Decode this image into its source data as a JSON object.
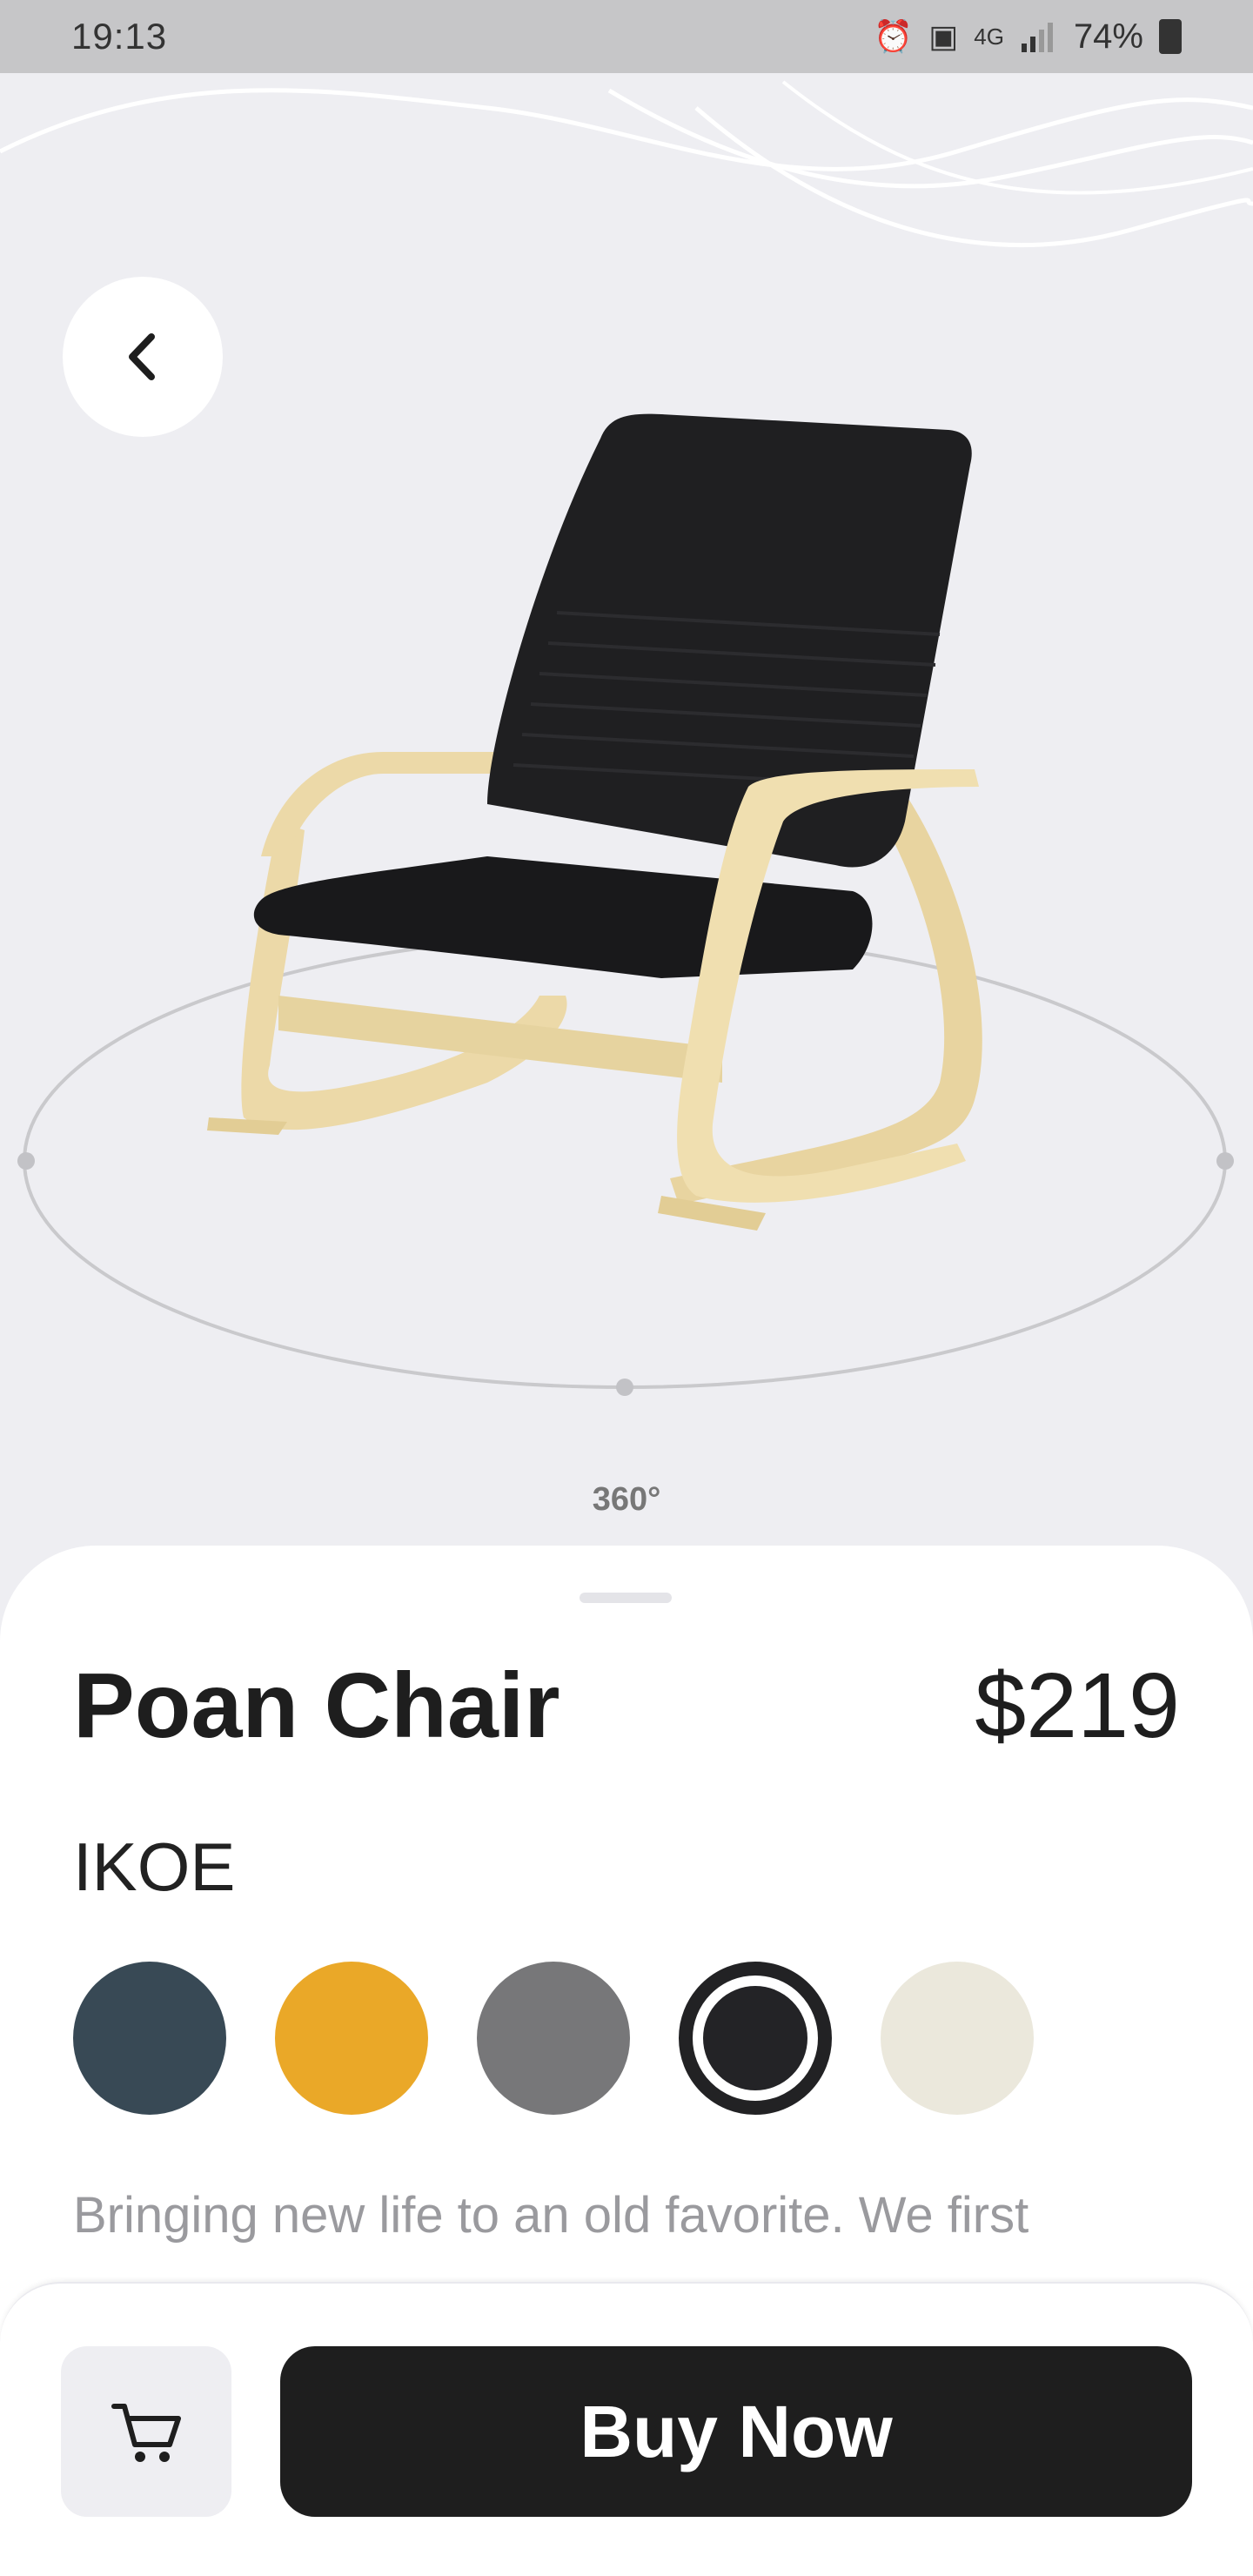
{
  "status_bar": {
    "time": "19:13",
    "network": "4G",
    "battery": "74%",
    "icons": [
      "alarm-icon",
      "battery-saver-icon",
      "network-4g-icon",
      "signal-icon",
      "battery-charging-icon"
    ]
  },
  "header": {
    "back_icon": "chevron-left-icon"
  },
  "viewer": {
    "rotation_label": "360°"
  },
  "product": {
    "name": "Poan Chair",
    "price": "$219",
    "brand": "IKOE",
    "colors": [
      {
        "name": "slate",
        "hex": "#384955"
      },
      {
        "name": "mustard",
        "hex": "#eaa828"
      },
      {
        "name": "gray",
        "hex": "#777779"
      },
      {
        "name": "black",
        "hex": "#232326",
        "selected": true
      },
      {
        "name": "cream",
        "hex": "#ebe8dc"
      }
    ],
    "description": "Bringing new life to an old favorite. We first"
  },
  "actions": {
    "cart_icon": "cart-icon",
    "buy_label": "Buy Now"
  },
  "colors": {
    "background": "#eeeef2",
    "primary": "#1e1e1e",
    "wood": "#ecd9a8"
  }
}
